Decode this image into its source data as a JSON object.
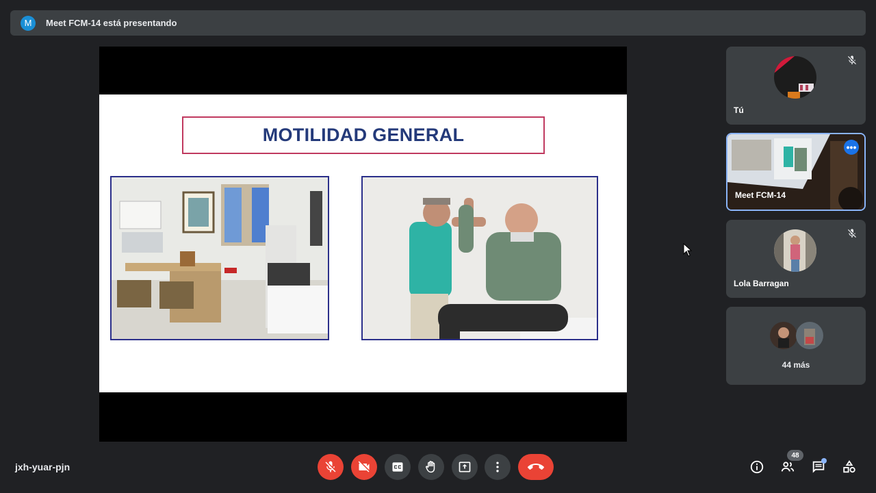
{
  "header": {
    "avatar_letter": "M",
    "presenting_text": "Meet FCM-14 está presentando"
  },
  "slide": {
    "title": "MOTILIDAD GENERAL"
  },
  "participants": [
    {
      "name": "Tú",
      "muted": true
    },
    {
      "name": "Meet FCM-14",
      "active": true
    },
    {
      "name": "Lola Barragan",
      "muted": true
    },
    {
      "more_label": "44 más"
    }
  ],
  "footer": {
    "meeting_code": "jxh-yuar-pjn",
    "participant_count": "48"
  },
  "icons": {
    "mic": "mic-off-icon",
    "camera": "videocam-off-icon",
    "captions": "closed-caption-icon",
    "hand": "raise-hand-icon",
    "present": "present-screen-icon",
    "more": "more-vert-icon",
    "hangup": "call-end-icon",
    "info": "info-icon",
    "people": "people-icon",
    "chat": "chat-icon",
    "activities": "activities-icon"
  },
  "colors": {
    "red": "#ea4335",
    "grey": "#3c4043",
    "accent": "#8ab4f8",
    "title": "#243a7a",
    "title_border": "#c0395f"
  }
}
